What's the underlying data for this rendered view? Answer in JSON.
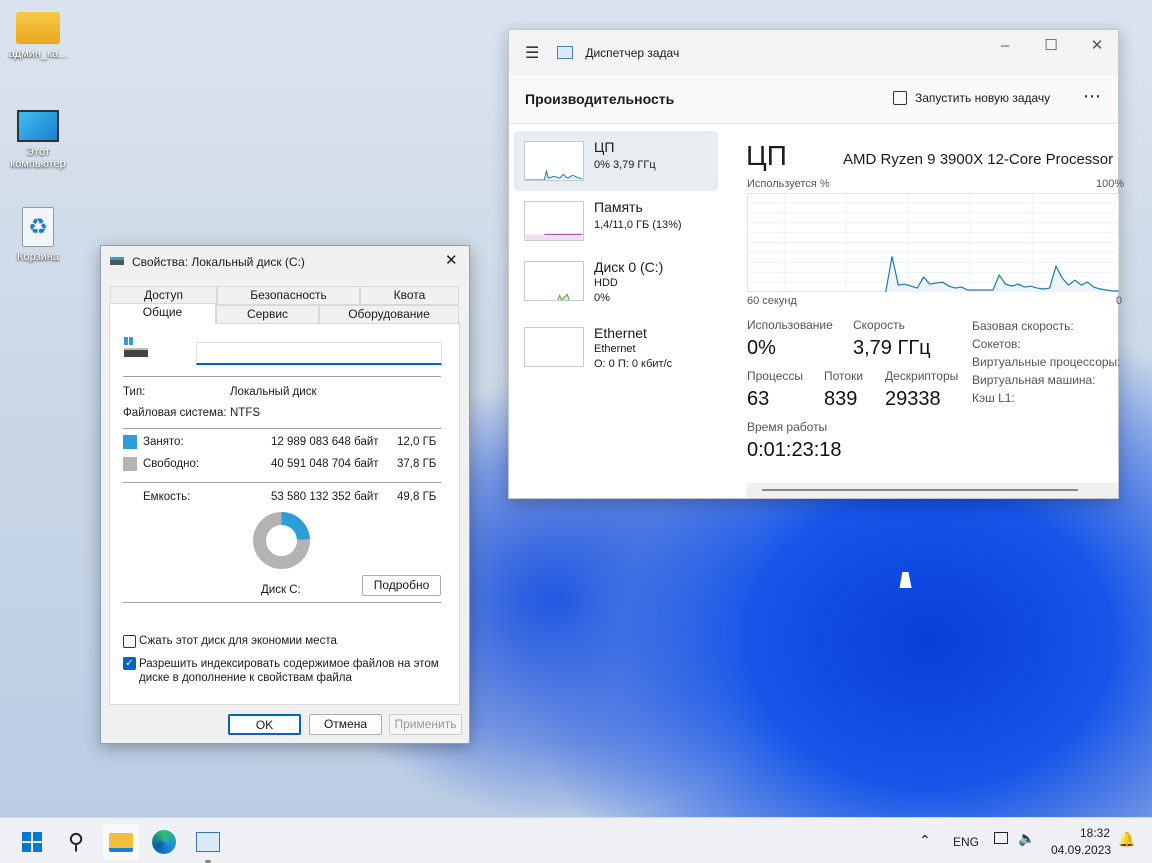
{
  "desktop": {
    "icons": [
      {
        "label": "админ_ка..."
      },
      {
        "label": "Этот компьютер"
      },
      {
        "label": "Корзина"
      }
    ]
  },
  "taskmgr": {
    "title": "Диспетчер задач",
    "section": "Производительность",
    "run_task": "Запустить новую задачу",
    "more": "⋯",
    "items": [
      {
        "title": "ЦП",
        "sub1": "0% 3,79 ГГц"
      },
      {
        "title": "Память",
        "sub1": "1,4/11,0 ГБ (13%)"
      },
      {
        "title": "Диск 0 (C:)",
        "sub1": "HDD",
        "sub2": "0%"
      },
      {
        "title": "Ethernet",
        "sub1": "Ethernet",
        "sub2": "О: 0 П: 0 кбит/с"
      }
    ],
    "cpu": {
      "heading": "ЦП",
      "model": "AMD Ryzen 9 3900X 12-Core Processor",
      "graph_label": "Используется %",
      "graph_max": "100%",
      "graph_time": "60 секунд",
      "graph_min": "0",
      "history": [
        0,
        0,
        0,
        0,
        0,
        0,
        0,
        0,
        0,
        0,
        0,
        0,
        0,
        0,
        0,
        0,
        0,
        0,
        0,
        0,
        0,
        0,
        0,
        36,
        7,
        8,
        6,
        4,
        15,
        8,
        9,
        10,
        6,
        4,
        5,
        2,
        2,
        2,
        2,
        2,
        17,
        8,
        6,
        8,
        5,
        6,
        4,
        3,
        4,
        26,
        14,
        7,
        12,
        7,
        10,
        5,
        3,
        2,
        1,
        1
      ],
      "usage_label": "Использование",
      "usage": "0%",
      "speed_label": "Скорость",
      "speed": "3,79 ГГц",
      "proc_label": "Процессы",
      "proc": "63",
      "threads_label": "Потоки",
      "threads": "839",
      "handles_label": "Дескрипторы",
      "handles": "29338",
      "uptime_label": "Время работы",
      "uptime": "0:01:23:18",
      "specs": [
        "Базовая скорость:",
        "Сокетов:",
        "Виртуальные процессоры:",
        "Виртуальная машина:",
        "Кэш L1:"
      ]
    }
  },
  "dialog": {
    "title": "Свойства: Локальный диск (C:)",
    "tabs_back": [
      "Доступ",
      "Безопасность",
      "Квота"
    ],
    "tabs_front": [
      "Общие",
      "Сервис",
      "Оборудование"
    ],
    "name_value": "",
    "type_label": "Тип:",
    "type": "Локальный диск",
    "fs_label": "Файловая система:",
    "fs": "NTFS",
    "used_label": "Занято:",
    "used_bytes": "12 989 083 648 байт",
    "used_gb": "12,0 ГБ",
    "free_label": "Свободно:",
    "free_bytes": "40 591 048 704 байт",
    "free_gb": "37,8 ГБ",
    "cap_label": "Емкость:",
    "cap_bytes": "53 580 132 352 байт",
    "cap_gb": "49,8 ГБ",
    "used_fraction": 0.242,
    "used_color": "#2b9fd9",
    "free_color": "#b3b3b3",
    "disk_label": "Диск C:",
    "details": "Подробно",
    "compress": {
      "label": "Сжать этот диск для экономии места",
      "checked": false
    },
    "index": {
      "label": "Разрешить индексировать содержимое файлов на этом диске в дополнение к свойствам файла",
      "checked": true
    },
    "ok": "OK",
    "cancel": "Отмена",
    "apply": "Применить"
  },
  "taskbar": {
    "lang": "ENG",
    "time": "18:32",
    "date": "04.09.2023"
  }
}
